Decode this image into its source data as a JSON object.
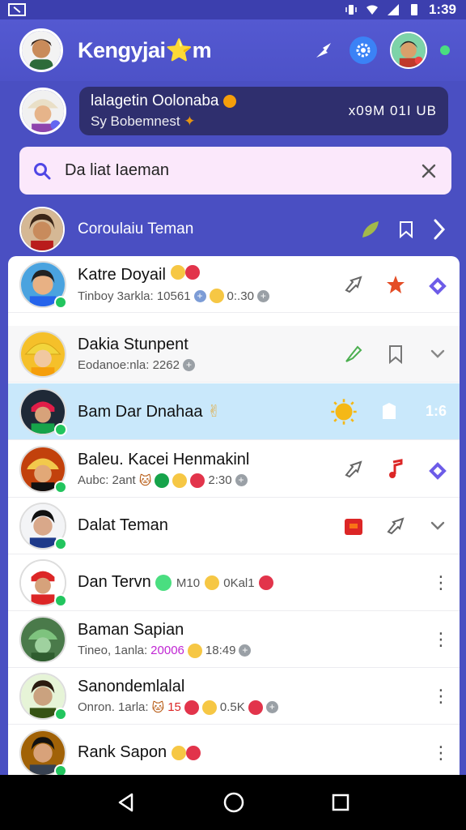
{
  "status_bar": {
    "time": "1:39"
  },
  "header": {
    "title": "Kengyjai",
    "title_emoji": "⭐",
    "title_suffix": "m"
  },
  "profile": {
    "status_line1": "lalagetin Oolonaba",
    "status_line2": "Sy Bobemnest",
    "status_right": "x09M 01I UB"
  },
  "search": {
    "placeholder": "Da liat Iaeman"
  },
  "contacts_bar": {
    "label": "Coroulaiu Teman"
  },
  "chats": [
    {
      "name": "Katre Doyail",
      "sub": "Tinboy 3arkla: 10561",
      "sub_tail": "0:.30",
      "actions": [
        "share-icon",
        "star-icon",
        "pin-icon"
      ]
    },
    {
      "name": "Dakia Stunpent",
      "sub": "Eodanoe:nla: 2262",
      "sub_tail": "",
      "actions": [
        "share-icon",
        "bookmark-icon",
        "chevron-down-icon"
      ]
    },
    {
      "name": "Bam Dar Dnahaa",
      "sub": "",
      "sub_tail": "",
      "time": "1:6",
      "actions": [
        "sun-icon",
        "bookmark-icon"
      ]
    },
    {
      "name": "Baleu. Kacei Henmakinl",
      "sub": "Aubc: 2ant",
      "sub_tail": "2:30",
      "actions": [
        "share-icon",
        "music-icon",
        "pin-icon"
      ]
    },
    {
      "name": "Dalat Teman",
      "sub": "",
      "sub_tail": "",
      "actions": [
        "red-tag-icon",
        "share-icon",
        "chevron-down-icon"
      ]
    },
    {
      "name": "Dan Tervn",
      "sub": "M10",
      "sub_tail": "0Kal1",
      "actions": [
        "more-icon"
      ]
    },
    {
      "name": "Baman Sapian",
      "sub": "Tineo, 1anla:",
      "sub_num": "20006",
      "sub_tail": "18:49",
      "actions": [
        "more-icon"
      ]
    },
    {
      "name": "Sanondemlalal",
      "sub": "Onron. 1arla:",
      "sub_num": "15",
      "sub_tail": "0.5K",
      "actions": [
        "more-icon"
      ]
    },
    {
      "name": "Rank Sapon",
      "sub": "",
      "sub_tail": "",
      "actions": [
        "more-icon"
      ]
    }
  ],
  "colors": {
    "header_bg": "#4d52c8",
    "highlight_row": "#c9e8fb",
    "search_bg": "#fbe8fb",
    "online_badge": "#22c55e"
  }
}
